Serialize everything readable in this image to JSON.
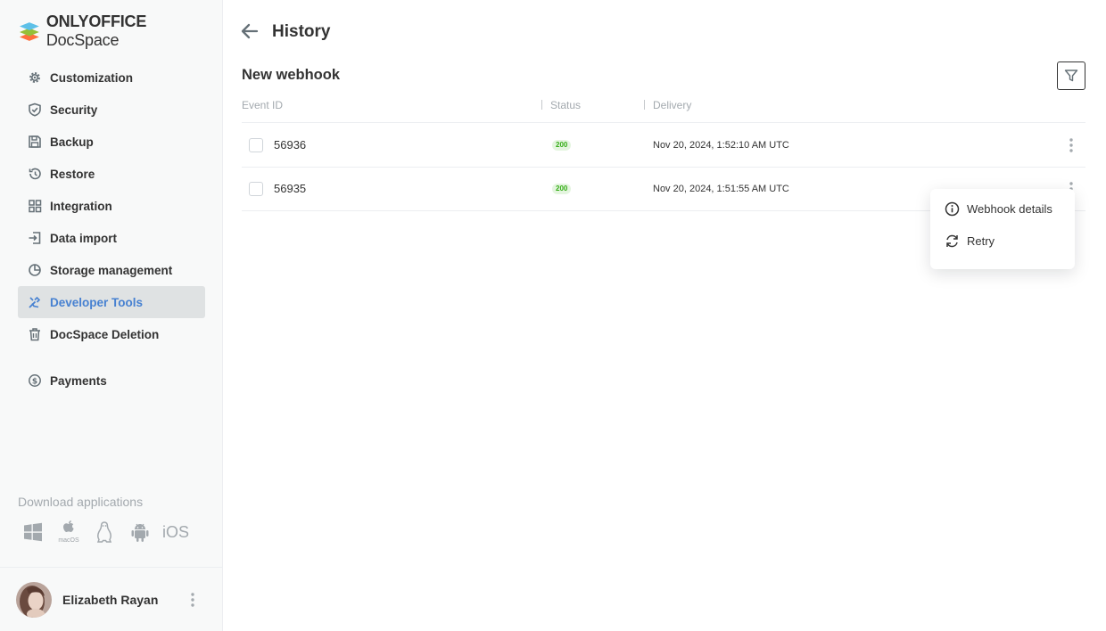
{
  "brand": {
    "bold": "ONLYOFFICE",
    "regular": " DocSpace"
  },
  "nav": [
    {
      "label": "Customization",
      "icon": "gear-icon"
    },
    {
      "label": "Security",
      "icon": "shield-icon"
    },
    {
      "label": "Backup",
      "icon": "floppy-icon"
    },
    {
      "label": "Restore",
      "icon": "restore-icon"
    },
    {
      "label": "Integration",
      "icon": "grid-icon"
    },
    {
      "label": "Data import",
      "icon": "import-icon"
    },
    {
      "label": "Storage management",
      "icon": "pie-icon"
    },
    {
      "label": "Developer Tools",
      "icon": "tools-icon",
      "active": true
    },
    {
      "label": "DocSpace Deletion",
      "icon": "trash-icon"
    },
    {
      "label": "Payments",
      "icon": "dollar-icon"
    }
  ],
  "download": {
    "title": "Download applications",
    "apps": [
      "windows-icon",
      "apple-icon",
      "linux-icon",
      "android-icon",
      "ios-icon"
    ],
    "macos_label": "macOS",
    "ios_label": "iOS"
  },
  "user": {
    "name": "Elizabeth Rayan"
  },
  "header": {
    "title": "History",
    "subtitle": "New webhook"
  },
  "table": {
    "columns": [
      "Event ID",
      "Status",
      "Delivery"
    ],
    "rows": [
      {
        "id": "56936",
        "status": "200",
        "delivery": "Nov 20, 2024, 1:52:10 AM UTC"
      },
      {
        "id": "56935",
        "status": "200",
        "delivery": "Nov 20, 2024, 1:51:55 AM UTC"
      }
    ]
  },
  "context_menu": [
    {
      "label": "Webhook details",
      "icon": "info-icon"
    },
    {
      "label": "Retry",
      "icon": "retry-icon"
    }
  ],
  "colors": {
    "accent": "#4781d1",
    "status_ok_bg": "#e4f5df",
    "status_ok_text": "#35ad17"
  }
}
